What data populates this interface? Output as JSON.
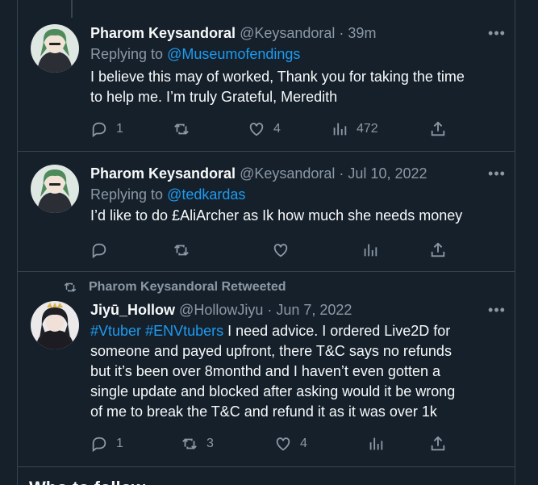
{
  "tweets": [
    {
      "author": "Pharom Keysandoral",
      "handle": "@Keysandoral",
      "time": "39m",
      "replying_to_label": "Replying to ",
      "replying_to": "@Museumofendings",
      "text_lines": [
        "I believe this may of worked, Thank you for taking the time",
        "to help me. I’m truly Grateful, Meredith"
      ],
      "replies": "1",
      "retweets": "",
      "likes": "4",
      "views": "472"
    },
    {
      "author": "Pharom Keysandoral",
      "handle": "@Keysandoral",
      "time": "Jul 10, 2022",
      "replying_to_label": "Replying to ",
      "replying_to": "@tedkardas",
      "text_lines": [
        "I’d like to do £AliArcher as Ik how much she needs money"
      ],
      "replies": "",
      "retweets": "",
      "likes": "",
      "views": ""
    },
    {
      "retweeted_by": "Pharom Keysandoral Retweeted",
      "author": "Jiyū_Hollow",
      "handle": "@HollowJiyu",
      "time": "Jun 7, 2022",
      "hashtags": [
        "#Vtuber",
        "#ENVtubers"
      ],
      "text_first": " I need advice. I ordered Live2D for",
      "text_lines": [
        "someone and payed upfront, there T&C says no refunds",
        "but it’s been over 8monthd and I haven’t even gotten a",
        "single update and blocked after asking would it be wrong",
        "of me to break the T&C and refund it as it was over 1k"
      ],
      "replies": "1",
      "retweets": "3",
      "likes": "4",
      "views": ""
    }
  ],
  "separator": " · ",
  "more_glyph": "•••",
  "bottom_heading_peek": "Who to follow",
  "icons": [
    "reply-icon",
    "retweet-icon",
    "like-icon",
    "views-icon",
    "share-icon",
    "more-icon"
  ],
  "colors": {
    "background": "#15202b",
    "border": "#38444d",
    "muted": "#8b98a5",
    "link": "#1d9bf0",
    "text": "#f7f9f9"
  }
}
